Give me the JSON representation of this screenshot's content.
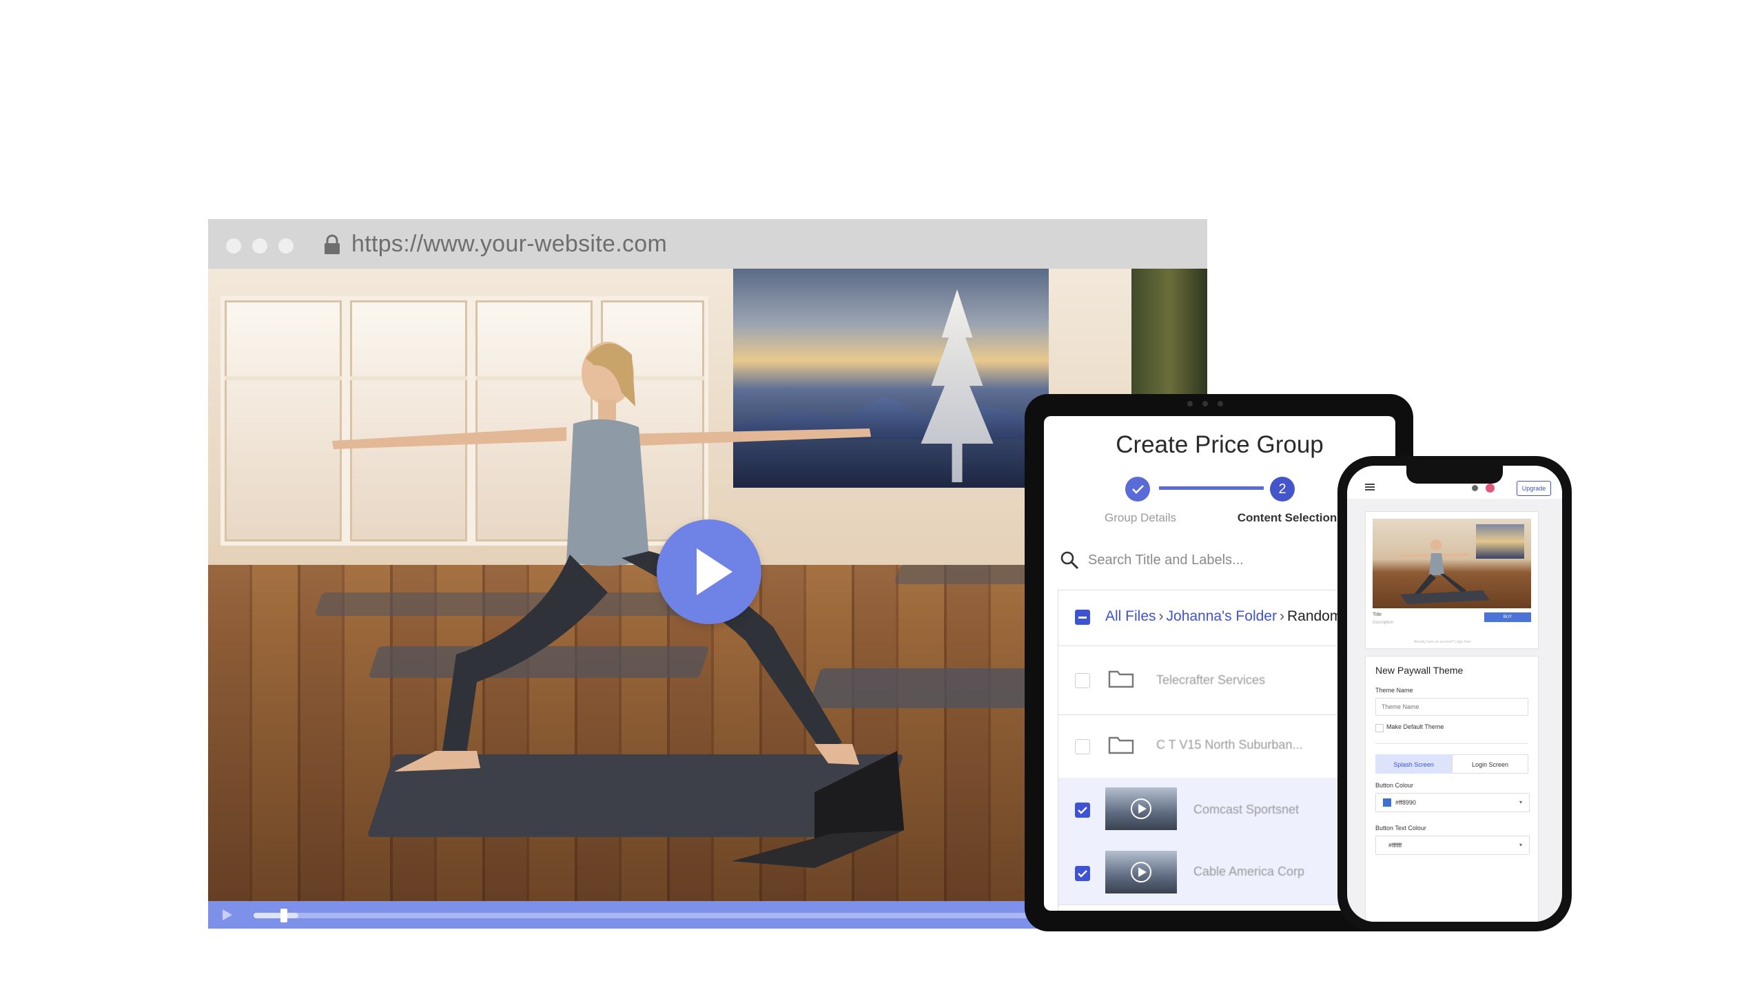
{
  "browser": {
    "url": "https://www.your-website.com",
    "icons": [
      "lock-icon",
      "play-icon"
    ],
    "video": {
      "progress": 0.05
    }
  },
  "tablet": {
    "title": "Create Price Group",
    "steps": [
      {
        "number": "",
        "label": "Group Details",
        "state": "complete"
      },
      {
        "number": "2",
        "label": "Content Selection",
        "state": "active"
      }
    ],
    "search": {
      "placeholder": "Search Title and Labels..."
    },
    "breadcrumb": {
      "root": "All Files",
      "folder": "Johanna's Folder",
      "current": "Random"
    },
    "items": [
      {
        "type": "folder",
        "name": "Telecrafter Services",
        "checked": false
      },
      {
        "type": "folder",
        "name": "C T V15 North Suburban...",
        "checked": false
      },
      {
        "type": "video",
        "name": "Comcast Sportsnet",
        "checked": true
      },
      {
        "type": "video",
        "name": "Cable America Corp",
        "checked": true
      }
    ],
    "colors": {
      "accent": "#3d52d5"
    }
  },
  "phone": {
    "upgrade_label": "Upgrade",
    "preview": {
      "title_label": "Title",
      "description_label": "Description",
      "buy_label": "BUY",
      "fine_print": "Already have an account? Login here"
    },
    "form": {
      "heading": "New Paywall Theme",
      "theme_name_label": "Theme Name",
      "theme_name_placeholder": "Theme Name",
      "default_checkbox_label": "Make Default Theme",
      "tabs": [
        "Splash Screen",
        "Login Screen"
      ],
      "button_colour_label": "Button Colour",
      "button_colour_value": "#ff8990",
      "button_colour_swatch": "#3d6fd8",
      "button_text_colour_label": "Button Text Colour",
      "button_text_colour_value": "#ffffff"
    }
  }
}
